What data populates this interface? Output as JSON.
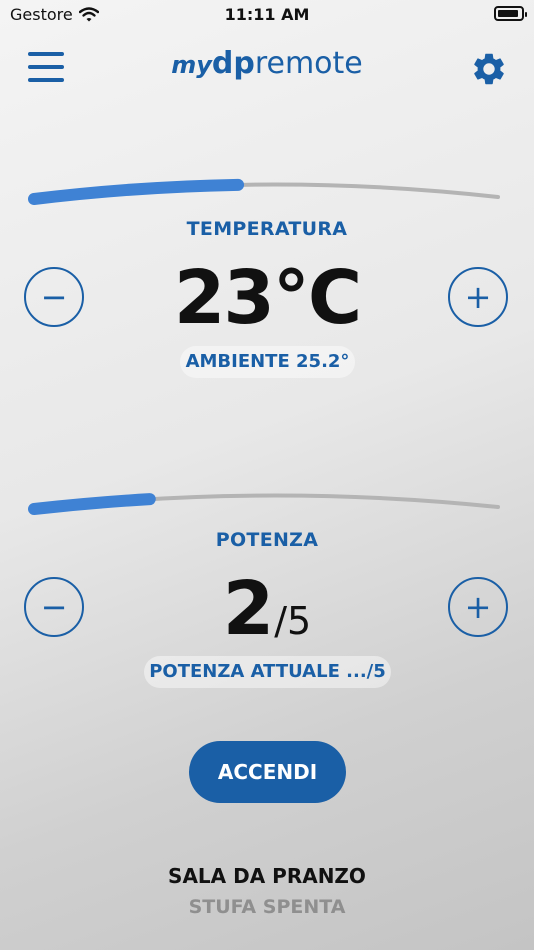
{
  "status_bar": {
    "carrier": "Gestore",
    "time": "11:11 AM",
    "battery_level": 0.9
  },
  "header": {
    "logo_my": "my",
    "logo_dp": "dp",
    "logo_remote": "remote",
    "menu_icon": "hamburger-menu-icon",
    "settings_icon": "gear-icon"
  },
  "temperature": {
    "label": "TEMPERATURA",
    "value": "23°C",
    "ambient_text": "AMBIENTE 25.2°",
    "slider_level": 0.44,
    "minus_symbol": "−",
    "plus_symbol": "+"
  },
  "power": {
    "label": "POTENZA",
    "value": "2",
    "max": "/5",
    "current_text": "POTENZA ATTUALE .../5",
    "slider_level": 0.25,
    "minus_symbol": "−",
    "plus_symbol": "+"
  },
  "action": {
    "label": "ACCENDI"
  },
  "device": {
    "room": "SALA DA PRANZO",
    "status": "STUFA SPENTA"
  },
  "colors": {
    "accent": "#1a5fa6",
    "slider_fill": "#3f82d4",
    "slider_track": "#b4b4b4",
    "status_grey": "#8f8f8f"
  }
}
